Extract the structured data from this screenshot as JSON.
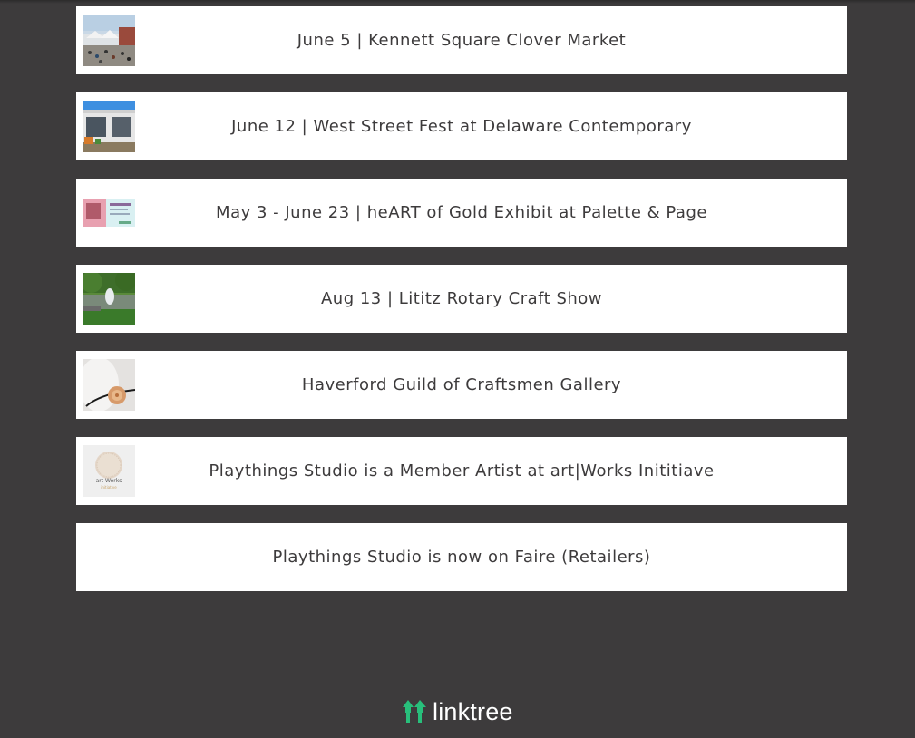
{
  "links": [
    {
      "label": "June 5 | Kennett Square Clover Market",
      "thumb": "market-photo"
    },
    {
      "label": "June 12 | West Street Fest at Delaware Contemporary",
      "thumb": "building-photo"
    },
    {
      "label": "May 3 - June 23 | heART of Gold Exhibit at Palette & Page",
      "thumb": "exhibit-flyer"
    },
    {
      "label": "Aug 13 | Lititz Rotary Craft Show",
      "thumb": "park-fountain-photo"
    },
    {
      "label": "Haverford Guild of Craftsmen Gallery",
      "thumb": "necklace-photo"
    },
    {
      "label": "Playthings Studio is a Member Artist at art|Works Inititiave",
      "thumb": "artworks-logo"
    },
    {
      "label": "Playthings Studio is now on Faire (Retailers)",
      "thumb": null
    }
  ],
  "thumb_texts": {
    "artworks": "art Works",
    "artworks_sub": "initiative"
  },
  "footer": {
    "logo_text": "linktree",
    "logo_icon": "linktree-icon",
    "logo_color": "#28bf7b"
  },
  "colors": {
    "background": "#3d3b3c",
    "card": "#ffffff",
    "text": "#3d3b3c"
  }
}
